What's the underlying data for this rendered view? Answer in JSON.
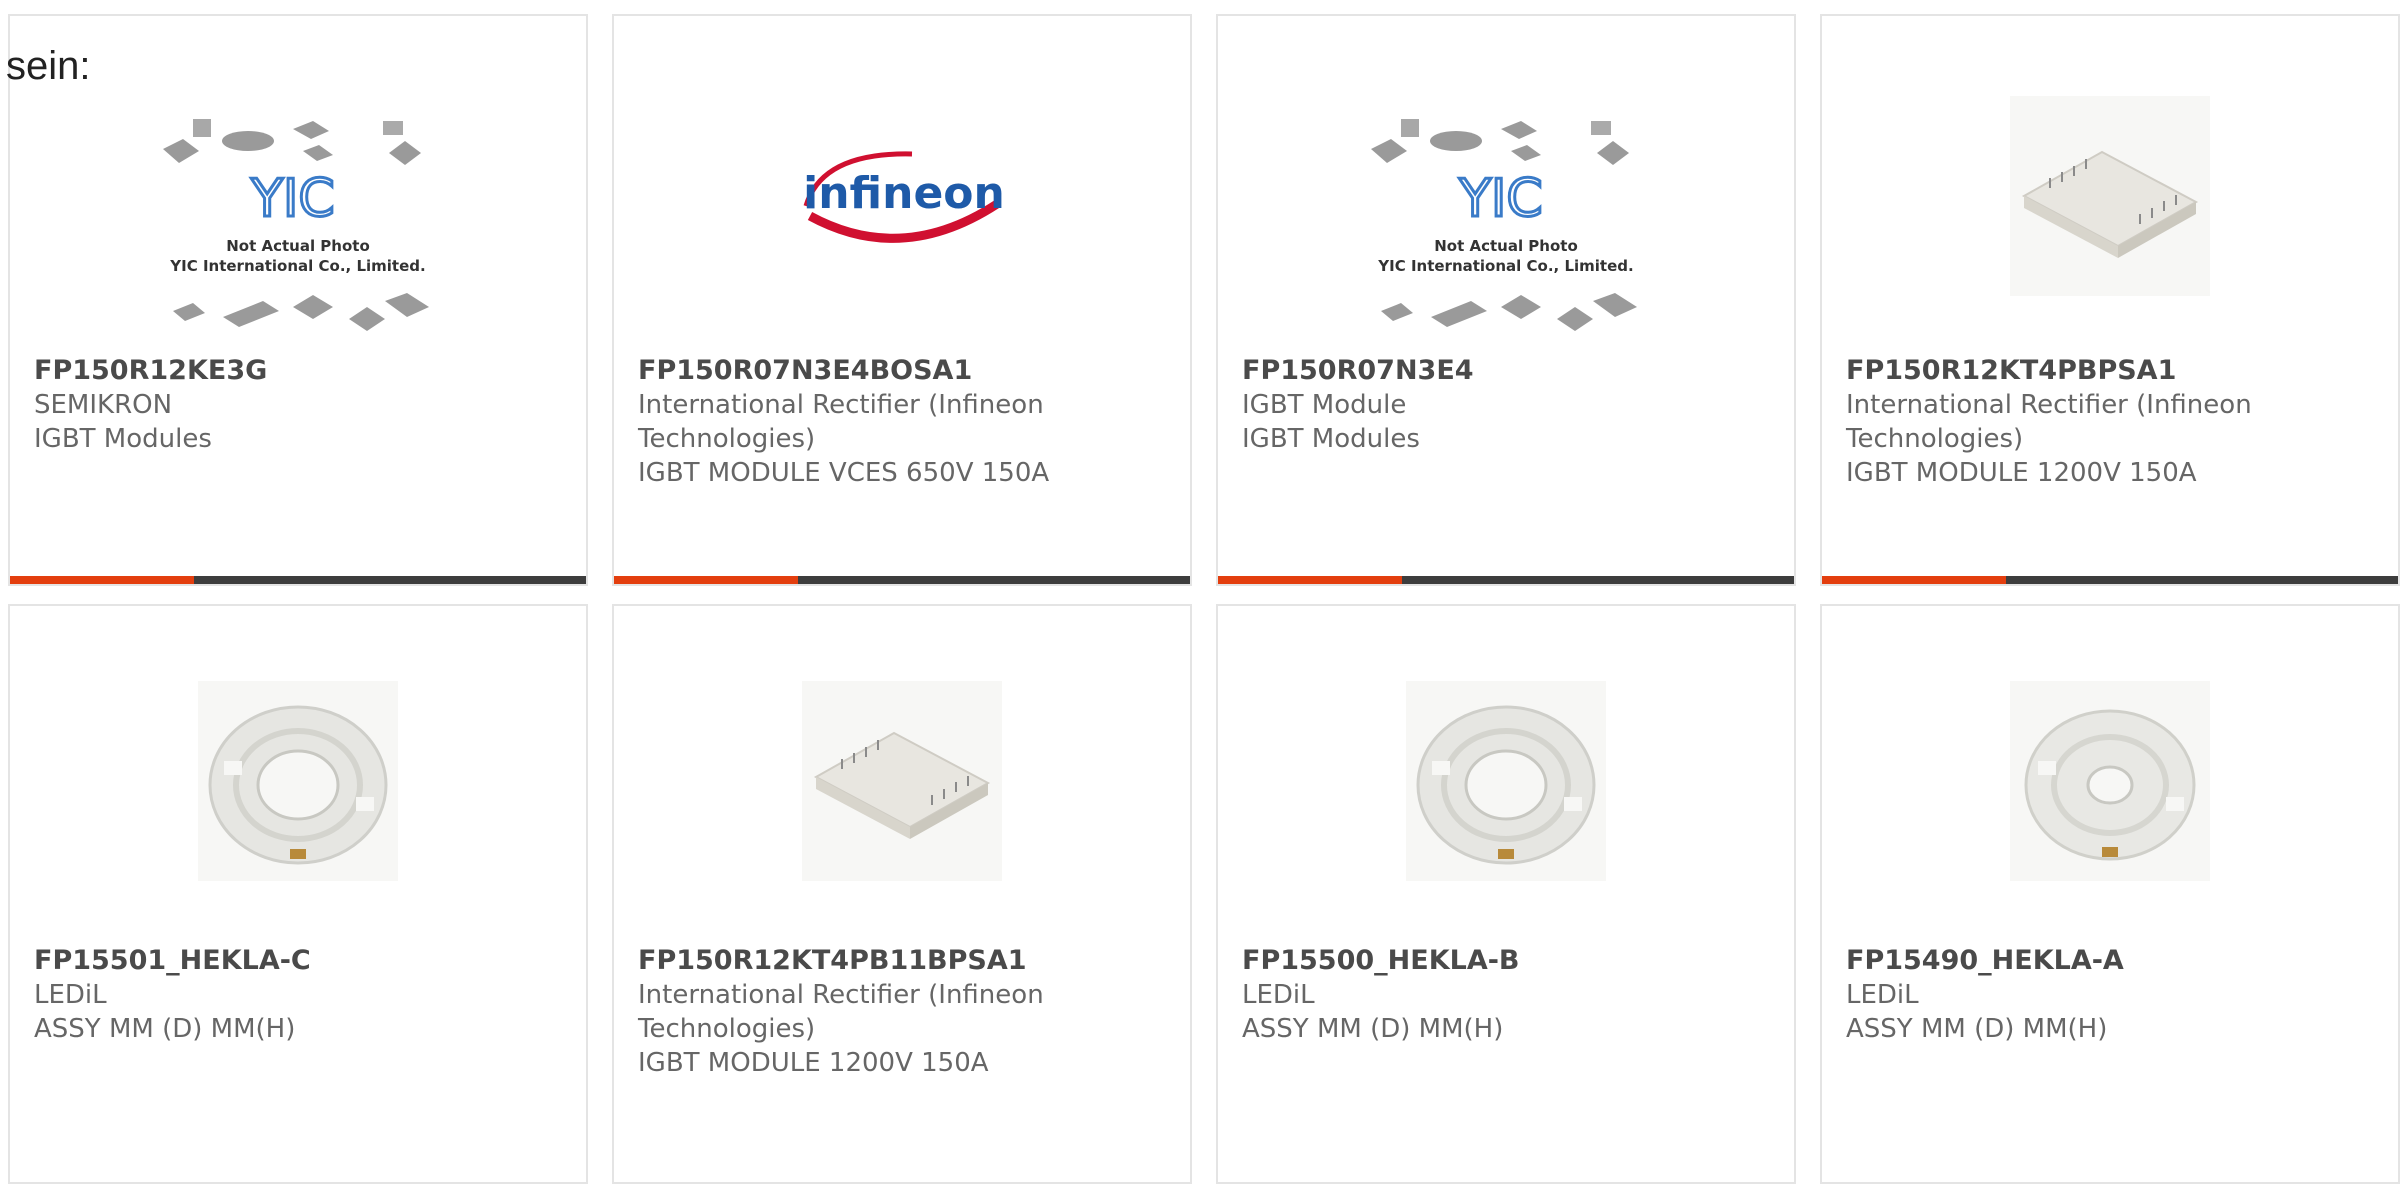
{
  "intro_text": "sein:",
  "colors": {
    "accent": "#e33e0e",
    "bar": "#3d3d3d",
    "border": "#e4e4e4"
  },
  "products": [
    {
      "part": "FP150R12KE3G",
      "manufacturer": "SEMIKRON",
      "description": "IGBT Modules",
      "image": "yic-placeholder",
      "placeholder_line1": "Not Actual Photo",
      "placeholder_line2": "YIC International Co., Limited.",
      "placeholder_logo": "YIC"
    },
    {
      "part": "FP150R07N3E4BOSA1",
      "manufacturer": "International Rectifier (Infineon Technologies)",
      "description": "IGBT MODULE VCES 650V 150A",
      "image": "infineon-logo",
      "logo_text": "infineon"
    },
    {
      "part": "FP150R07N3E4",
      "manufacturer": "IGBT Module",
      "description": "IGBT Modules",
      "image": "yic-placeholder",
      "placeholder_line1": "Not Actual Photo",
      "placeholder_line2": "YIC International Co., Limited.",
      "placeholder_logo": "YIC"
    },
    {
      "part": "FP150R12KT4PBPSA1",
      "manufacturer": "International Rectifier (Infineon Technologies)",
      "description": "IGBT MODULE 1200V 150A",
      "image": "igbt-module-photo"
    },
    {
      "part": "FP15501_HEKLA-C",
      "manufacturer": "LEDiL",
      "description": "ASSY MM (D) MM(H)",
      "image": "led-ring-holder-photo"
    },
    {
      "part": "FP150R12KT4PB11BPSA1",
      "manufacturer": "International Rectifier (Infineon Technologies)",
      "description": "IGBT MODULE 1200V 150A",
      "image": "igbt-module-photo"
    },
    {
      "part": "FP15500_HEKLA-B",
      "manufacturer": "LEDiL",
      "description": "ASSY MM (D) MM(H)",
      "image": "led-ring-holder-photo"
    },
    {
      "part": "FP15490_HEKLA-A",
      "manufacturer": "LEDiL",
      "description": "ASSY MM (D) MM(H)",
      "image": "led-ring-holder-photo"
    }
  ]
}
